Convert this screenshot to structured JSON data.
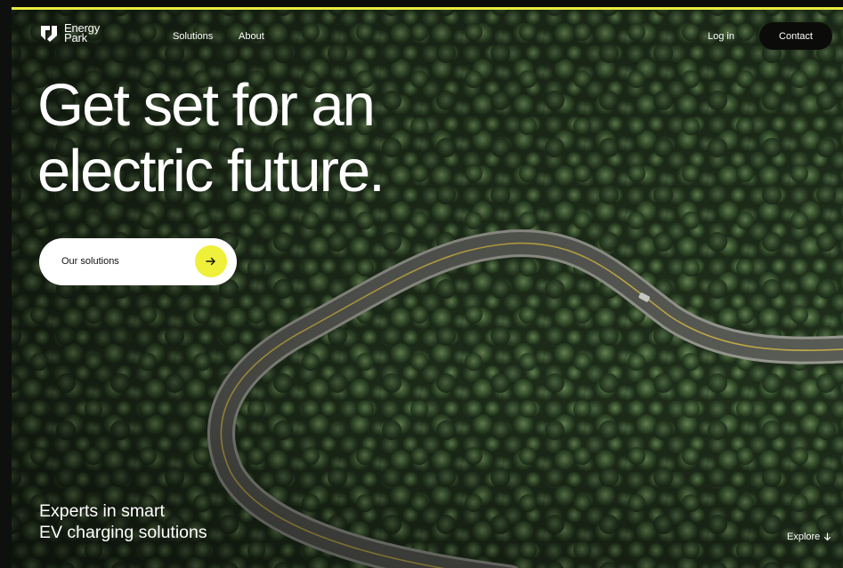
{
  "brand": {
    "name_line1": "Energy",
    "name_line2": "Park",
    "accent_color": "#e8ec3d"
  },
  "nav": {
    "links": [
      {
        "label": "Solutions"
      },
      {
        "label": "About"
      }
    ],
    "login_label": "Log in",
    "contact_label": "Contact"
  },
  "hero": {
    "headline_line1": "Get set for an",
    "headline_line2": "electric future.",
    "cta_label": "Our solutions",
    "cta_icon": "arrow-right-icon",
    "tagline_line1": "Experts in smart",
    "tagline_line2": "EV charging solutions",
    "explore_label": "Explore",
    "explore_icon": "arrow-down-icon",
    "background": "aerial forest with winding road"
  }
}
